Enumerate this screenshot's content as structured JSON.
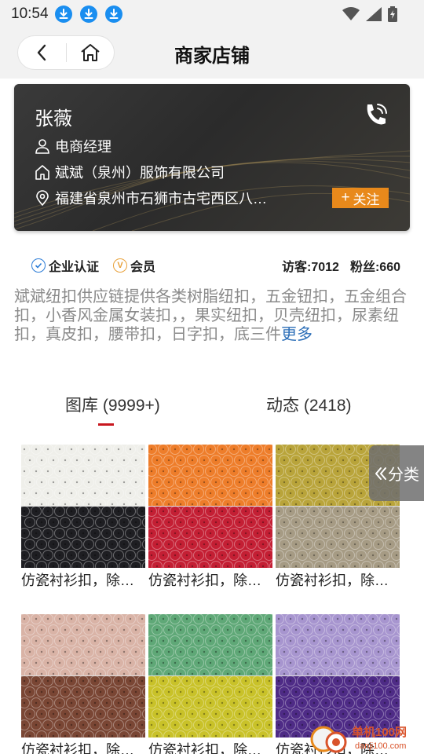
{
  "status_bar": {
    "time": "10:54"
  },
  "header": {
    "title": "商家店铺"
  },
  "merchant": {
    "name": "张薇",
    "title": "电商经理",
    "company": "斌斌（泉州）服饰有限公司",
    "address": "福建省泉州市石狮市古宅西区八…",
    "follow_label": "关注"
  },
  "stats": {
    "certification": "企业认证",
    "membership": "会员",
    "visitors": "访客:7012",
    "fans": "粉丝:660"
  },
  "description": {
    "text": "斌斌纽扣供应链提供各类树脂纽扣，五金钮扣，五金组合扣，小香风金属女装扣，，果实纽扣，贝壳纽扣，尿素纽扣，真皮扣，腰带扣，日字扣，底三件",
    "more_label": "更多"
  },
  "tabs": [
    {
      "label": "图库 (9999+)",
      "active": true
    },
    {
      "label": "动态 (2418)",
      "active": false
    }
  ],
  "category_label": "分类",
  "products": [
    {
      "caption": "仿瓷衬衫扣，除…",
      "top_color": "#efefea",
      "bottom_color": "#1e1e22"
    },
    {
      "caption": "仿瓷衬衫扣，除…",
      "top_color": "#ee7d2a",
      "bottom_color": "#c41f34"
    },
    {
      "caption": "仿瓷衬衫扣，除…",
      "top_color": "#b9a43a",
      "bottom_color": "#a69b84"
    },
    {
      "caption": "仿瓷衬衫扣，除…",
      "top_color": "#d9b3a6",
      "bottom_color": "#7a4634"
    },
    {
      "caption": "仿瓷衬衫扣，除…",
      "top_color": "#5fa877",
      "bottom_color": "#c9c229"
    },
    {
      "caption": "仿瓷衬衫扣，除…",
      "top_color": "#a795cf",
      "bottom_color": "#4e2b86"
    }
  ],
  "colors": {
    "accent_orange": "#e8891b",
    "tab_underline": "#c8171e",
    "link_blue": "#2d6fb8",
    "download_blue": "#1a8ef0"
  },
  "watermark": {
    "text": "单机100网",
    "subtext": "danji100.com"
  }
}
